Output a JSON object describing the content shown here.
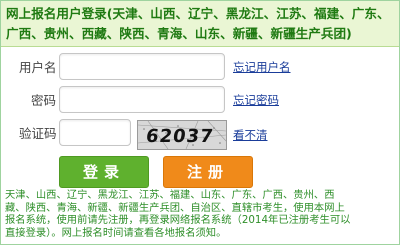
{
  "header": {
    "line1": "网上报名用户登录(天津、山西、辽宁、黑龙江、江苏、福建、广东、",
    "line2": "广西、贵州、西藏、陕西、青海、山东、新疆、新疆生产兵团)"
  },
  "form": {
    "username_label": "用户名",
    "username_value": "",
    "forgot_username": "忘记用户名",
    "password_label": "密码",
    "password_value": "",
    "forgot_password": "忘记密码",
    "captcha_label": "验证码",
    "captcha_value": "",
    "captcha_image_text": "62037",
    "captcha_refresh": "看不清"
  },
  "buttons": {
    "login": "登录",
    "register": "注册"
  },
  "notice": {
    "line1": "天津、山西、辽宁、黑龙江、江苏、福建、山东、广东、广西、贵州、西",
    "line2": "藏、陕西、青海、新疆、新疆生产兵团、自治区、直辖市考生，使用本网上",
    "line3": "报名系统，使用前请先注册，再登录网络报名系统（2014年已注册考生可以",
    "line4": "直接登录）。网上报名时间请查看各地报名须知。"
  },
  "colors": {
    "header_text": "#1f7a12",
    "login_button": "#5fb12e",
    "register_button": "#f08a1a",
    "notice_text": "#2f8f2a",
    "link": "#1a3d9a"
  }
}
